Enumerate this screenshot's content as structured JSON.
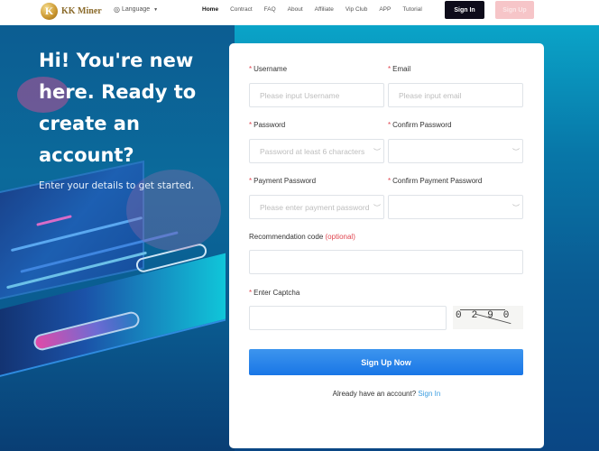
{
  "header": {
    "brand": "KK Miner",
    "brand_mark": "K",
    "language_label": "Language",
    "nav": [
      {
        "label": "Home",
        "active": true
      },
      {
        "label": "Contract",
        "active": false
      },
      {
        "label": "FAQ",
        "active": false
      },
      {
        "label": "About",
        "active": false
      },
      {
        "label": "Affiliate",
        "active": false
      },
      {
        "label": "Vip Club",
        "active": false
      },
      {
        "label": "APP",
        "active": false
      },
      {
        "label": "Tutorial",
        "active": false
      }
    ],
    "sign_in_label": "Sign In",
    "sign_up_label": "Sign Up"
  },
  "hero": {
    "title": "Hi! You're new here. Ready to create an account?",
    "subtitle": "Enter your details to get started."
  },
  "form": {
    "required_mark": "*",
    "username": {
      "label": "Username",
      "placeholder": "Please input Username",
      "value": ""
    },
    "email": {
      "label": "Email",
      "placeholder": "Please input email",
      "value": ""
    },
    "password": {
      "label": "Password",
      "placeholder": "Password at least 6 characters",
      "value": ""
    },
    "confirm_password": {
      "label": "Confirm Password",
      "placeholder": "",
      "value": ""
    },
    "payment_password": {
      "label": "Payment Password",
      "placeholder": "Please enter payment password",
      "value": ""
    },
    "confirm_payment_password": {
      "label": "Confirm Payment Password",
      "placeholder": "",
      "value": ""
    },
    "recommendation_code": {
      "label": "Recommendation code",
      "optional_label": "(optional)",
      "value": ""
    },
    "captcha": {
      "label": "Enter Captcha",
      "value": "",
      "image_text": "0290"
    },
    "submit_label": "Sign Up Now",
    "footer_text": "Already have an account?",
    "footer_link": "Sign In"
  },
  "icons": {
    "eye": "︶",
    "globe": "🌐",
    "caret": "▼"
  }
}
